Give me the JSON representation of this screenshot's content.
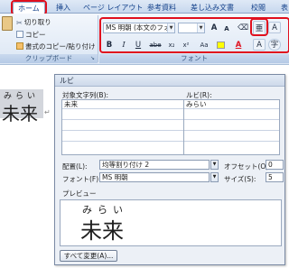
{
  "tabs": {
    "home": "ホーム",
    "insert": "挿入",
    "page_layout": "ページ レイアウト",
    "references": "参考資料",
    "mailings": "差し込み文書",
    "review": "校閲",
    "view": "表"
  },
  "clipboard": {
    "cut": "切り取り",
    "copy": "コピー",
    "format_painter": "書式のコピー/貼り付け",
    "group_label": "クリップボード"
  },
  "font_group": {
    "font_name": "MS 明朝 (本文のフォン",
    "group_label": "フォント",
    "grow": "A",
    "shrink": "A",
    "bold": "B",
    "italic": "I",
    "underline": "U",
    "strike": "abe",
    "subscript": "x₂",
    "superscript": "x²",
    "phonetic_ruby": "亜",
    "char_border": "A",
    "highlight_color": "#ffff00",
    "font_color": "#e0101e"
  },
  "document": {
    "ruby_text": "みらい",
    "base_text": "未来"
  },
  "dialog": {
    "title": "ルビ",
    "base_text_label": "対象文字列(B):",
    "ruby_label": "ルビ(R):",
    "rows": [
      {
        "base": "未来",
        "ruby": "みらい"
      },
      {
        "base": "",
        "ruby": ""
      },
      {
        "base": "",
        "ruby": ""
      },
      {
        "base": "",
        "ruby": ""
      },
      {
        "base": "",
        "ruby": ""
      }
    ],
    "alignment_label": "配置(L):",
    "alignment_value": "均等割り付け 2",
    "offset_label": "オフセット(O):",
    "offset_value": "0",
    "font_label": "フォント(F):",
    "font_value": "MS 明朝",
    "size_label": "サイズ(S):",
    "size_value": "5",
    "preview_label": "プレビュー",
    "preview_ruby": "みらい",
    "preview_base": "未来",
    "change_all_button": "すべて変更(A)..."
  }
}
